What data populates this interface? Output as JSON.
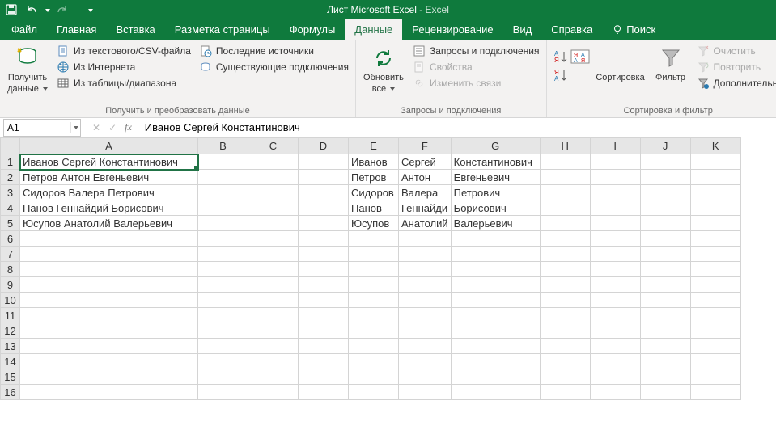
{
  "title": {
    "doc": "Лист Microsoft Excel",
    "sep": "  -  ",
    "app": "Excel"
  },
  "tabs": [
    "Файл",
    "Главная",
    "Вставка",
    "Разметка страницы",
    "Формулы",
    "Данные",
    "Рецензирование",
    "Вид",
    "Справка",
    "Поиск"
  ],
  "active_tab_index": 5,
  "ribbon": {
    "g1": {
      "label": "Получить и преобразовать данные",
      "bigbtn": {
        "line1": "Получить",
        "line2": "данные"
      },
      "items": [
        "Из текстового/CSV-файла",
        "Из Интернета",
        "Из таблицы/диапазона",
        "Последние источники",
        "Существующие подключения"
      ]
    },
    "g2": {
      "label": "Запросы и подключения",
      "bigbtn": {
        "line1": "Обновить",
        "line2": "все"
      },
      "items": [
        "Запросы и подключения",
        "Свойства",
        "Изменить связи"
      ]
    },
    "g3": {
      "label": "Сортировка и фильтр",
      "sort_label": "Сортировка",
      "filter_label": "Фильтр",
      "items": [
        "Очистить",
        "Повторить",
        "Дополнительно"
      ]
    }
  },
  "formula_bar": {
    "name": "A1",
    "value": "Иванов Сергей Константинович"
  },
  "columns": [
    "A",
    "B",
    "C",
    "D",
    "E",
    "F",
    "G",
    "H",
    "I",
    "J",
    "K"
  ],
  "row_count": 16,
  "sheet": {
    "A": [
      "Иванов Сергей Константинович",
      "Петров Антон Евгеньевич",
      "Сидоров Валера Петрович",
      "Панов Геннайдий Борисович",
      "Юсупов Анатолий Валерьевич"
    ],
    "E": [
      "Иванов",
      "Петров",
      "Сидоров",
      "Панов",
      "Юсупов"
    ],
    "F": [
      "Сергей",
      "Антон",
      "Валера",
      "Геннайди",
      "Анатолий"
    ],
    "G": [
      "Константинович",
      "Евгеньевич",
      "Петрович",
      "Борисович",
      "Валерьевич"
    ]
  },
  "selected_cell": "A1"
}
